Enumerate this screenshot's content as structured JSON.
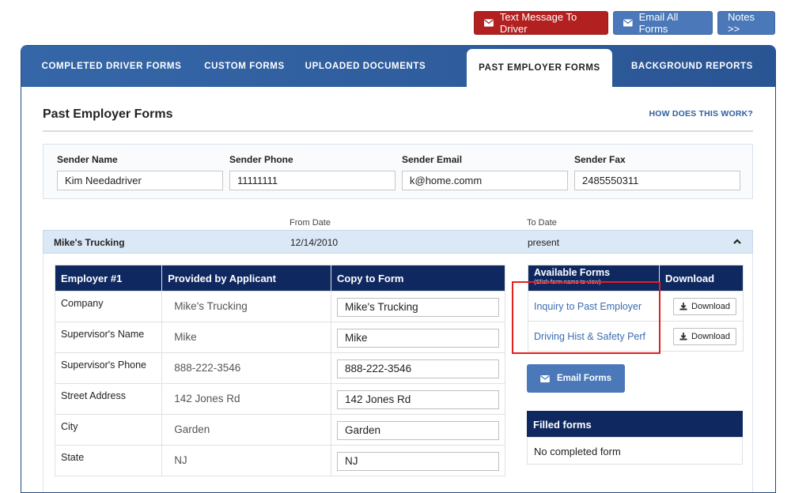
{
  "top_actions": {
    "text_driver": "Text Message To Driver",
    "email_all": "Email All Forms",
    "notes": "Notes >>",
    "colors": {
      "red": "#b32020",
      "blue": "#4a78b8"
    }
  },
  "tabs": [
    {
      "label": "COMPLETED DRIVER FORMS",
      "active": false
    },
    {
      "label": "CUSTOM FORMS",
      "active": false
    },
    {
      "label": "UPLOADED DOCUMENTS",
      "active": false
    },
    {
      "label": "PAST EMPLOYER FORMS",
      "active": true
    },
    {
      "label": "BACKGROUND REPORTS",
      "active": false
    }
  ],
  "section": {
    "title": "Past Employer Forms",
    "help_link": "HOW DOES THIS WORK?"
  },
  "sender": {
    "name_label": "Sender Name",
    "name_value": "Kim Needadriver",
    "phone_label": "Sender Phone",
    "phone_value": "11111111",
    "email_label": "Sender Email",
    "email_value": "k@home.comm",
    "fax_label": "Sender Fax",
    "fax_value": "2485550311"
  },
  "dates_header": {
    "from": "From Date",
    "to": "To Date"
  },
  "employer": {
    "name": "Mike's Trucking",
    "from": "12/14/2010",
    "to": "present",
    "table_headers": [
      "Employer #1",
      "Provided by Applicant",
      "Copy to Form"
    ],
    "rows": [
      {
        "field": "Company",
        "provided": "Mike's Trucking",
        "copy": "Mike's Trucking"
      },
      {
        "field": "Supervisor's Name",
        "provided": "Mike",
        "copy": "Mike"
      },
      {
        "field": "Supervisor's Phone",
        "provided": "888-222-3546",
        "copy": "888-222-3546"
      },
      {
        "field": "Street Address",
        "provided": "142 Jones Rd",
        "copy": "142 Jones Rd"
      },
      {
        "field": "City",
        "provided": "Garden",
        "copy": "Garden"
      },
      {
        "field": "State",
        "provided": "NJ",
        "copy": "NJ"
      }
    ]
  },
  "available_forms": {
    "header": "Available Forms",
    "subheader": "(Click form name to view)",
    "download_header": "Download",
    "forms": [
      {
        "name": "Inquiry to Past Employer",
        "download_label": "Download"
      },
      {
        "name": "Driving Hist & Safety Perf",
        "download_label": "Download"
      }
    ]
  },
  "email_forms_button": "Email Forms",
  "filled_forms": {
    "header": "Filled forms",
    "empty_text": "No completed form"
  }
}
